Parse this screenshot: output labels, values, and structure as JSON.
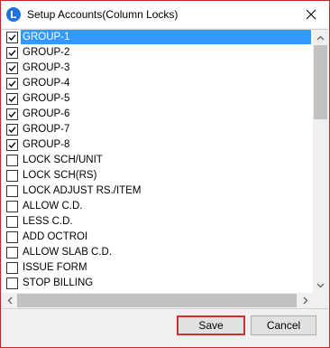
{
  "window": {
    "title": "Setup Accounts(Column Locks)",
    "accent_color": "#3399ff",
    "frame_color": "#c62828"
  },
  "icons": {
    "app": "app-logo-icon",
    "close": "close-icon",
    "checkbox_checked": "checkmark-icon"
  },
  "list": {
    "items": [
      {
        "label": "GROUP-1",
        "checked": true,
        "selected": true
      },
      {
        "label": "GROUP-2",
        "checked": true,
        "selected": false
      },
      {
        "label": "GROUP-3",
        "checked": true,
        "selected": false
      },
      {
        "label": "GROUP-4",
        "checked": true,
        "selected": false
      },
      {
        "label": "GROUP-5",
        "checked": true,
        "selected": false
      },
      {
        "label": "GROUP-6",
        "checked": true,
        "selected": false
      },
      {
        "label": "GROUP-7",
        "checked": true,
        "selected": false
      },
      {
        "label": "GROUP-8",
        "checked": true,
        "selected": false
      },
      {
        "label": "LOCK SCH/UNIT",
        "checked": false,
        "selected": false
      },
      {
        "label": "LOCK SCH(RS)",
        "checked": false,
        "selected": false
      },
      {
        "label": "LOCK ADJUST RS./ITEM",
        "checked": false,
        "selected": false
      },
      {
        "label": "ALLOW C.D.",
        "checked": false,
        "selected": false
      },
      {
        "label": "LESS C.D.",
        "checked": false,
        "selected": false
      },
      {
        "label": "ADD OCTROI",
        "checked": false,
        "selected": false
      },
      {
        "label": "ALLOW SLAB C.D.",
        "checked": false,
        "selected": false
      },
      {
        "label": "ISSUE FORM",
        "checked": false,
        "selected": false
      },
      {
        "label": "STOP BILLING",
        "checked": false,
        "selected": false
      }
    ]
  },
  "buttons": {
    "save_label": "Save",
    "cancel_label": "Cancel",
    "save_highlight_color": "#d32f2f"
  }
}
